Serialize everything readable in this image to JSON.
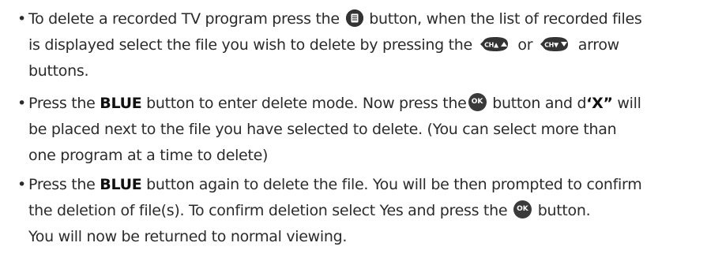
{
  "items": [
    {
      "bullet": "•",
      "lines": [
        [
          "To delete a recorded TV program press the ",
          " button, when the list of recorded files"
        ],
        [
          "is displayed select the file you wish to delete by pressing the ",
          " or ",
          " arrow"
        ],
        [
          "buttons."
        ]
      ]
    },
    {
      "bullet": "•",
      "lines": [
        [
          "Press the ",
          "BLUE",
          " button to enter delete mode. Now press the",
          " button and d",
          "‘X”",
          " will"
        ],
        [
          "be placed next to the file you have selected to delete. (You can select more than"
        ],
        [
          "one program at a time to delete)"
        ]
      ]
    },
    {
      "bullet": "•",
      "lines": [
        [
          "Press the ",
          "BLUE",
          " button again to delete the file. You will be then prompted to confirm"
        ],
        [
          "the deletion of file(s). To confirm deletion select Yes and press the ",
          " button."
        ],
        [
          "You will now be returned to normal viewing."
        ]
      ]
    }
  ],
  "icons": {
    "ok_label": "OK",
    "ch_up_label": "CH▲",
    "ch_down_label": "CH▼"
  },
  "colors": {
    "text": "#2b2b2b",
    "icon": "#333333"
  }
}
